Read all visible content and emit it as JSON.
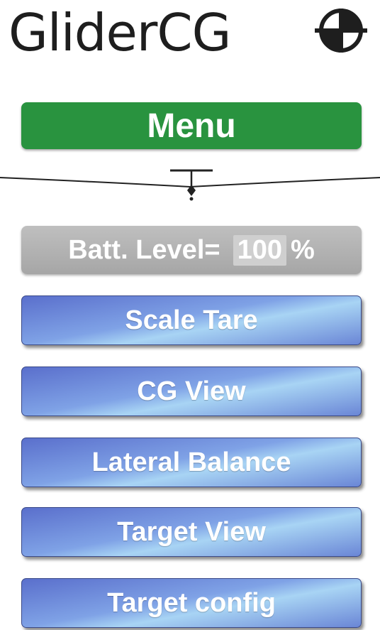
{
  "header": {
    "app_title": "GliderCG",
    "icon": "cg-symbol-icon"
  },
  "menu": {
    "title": "Menu"
  },
  "battery": {
    "label": "Batt. Level=",
    "value": "100",
    "unit": "%"
  },
  "buttons": [
    {
      "label": "Scale Tare"
    },
    {
      "label": "CG View"
    },
    {
      "label": "Lateral Balance"
    },
    {
      "label": "Target View"
    },
    {
      "label": "Target config"
    }
  ],
  "colors": {
    "menu_green": "#29933f",
    "button_blue": "#6a86d6",
    "battery_gray": "#a6a6a6"
  }
}
